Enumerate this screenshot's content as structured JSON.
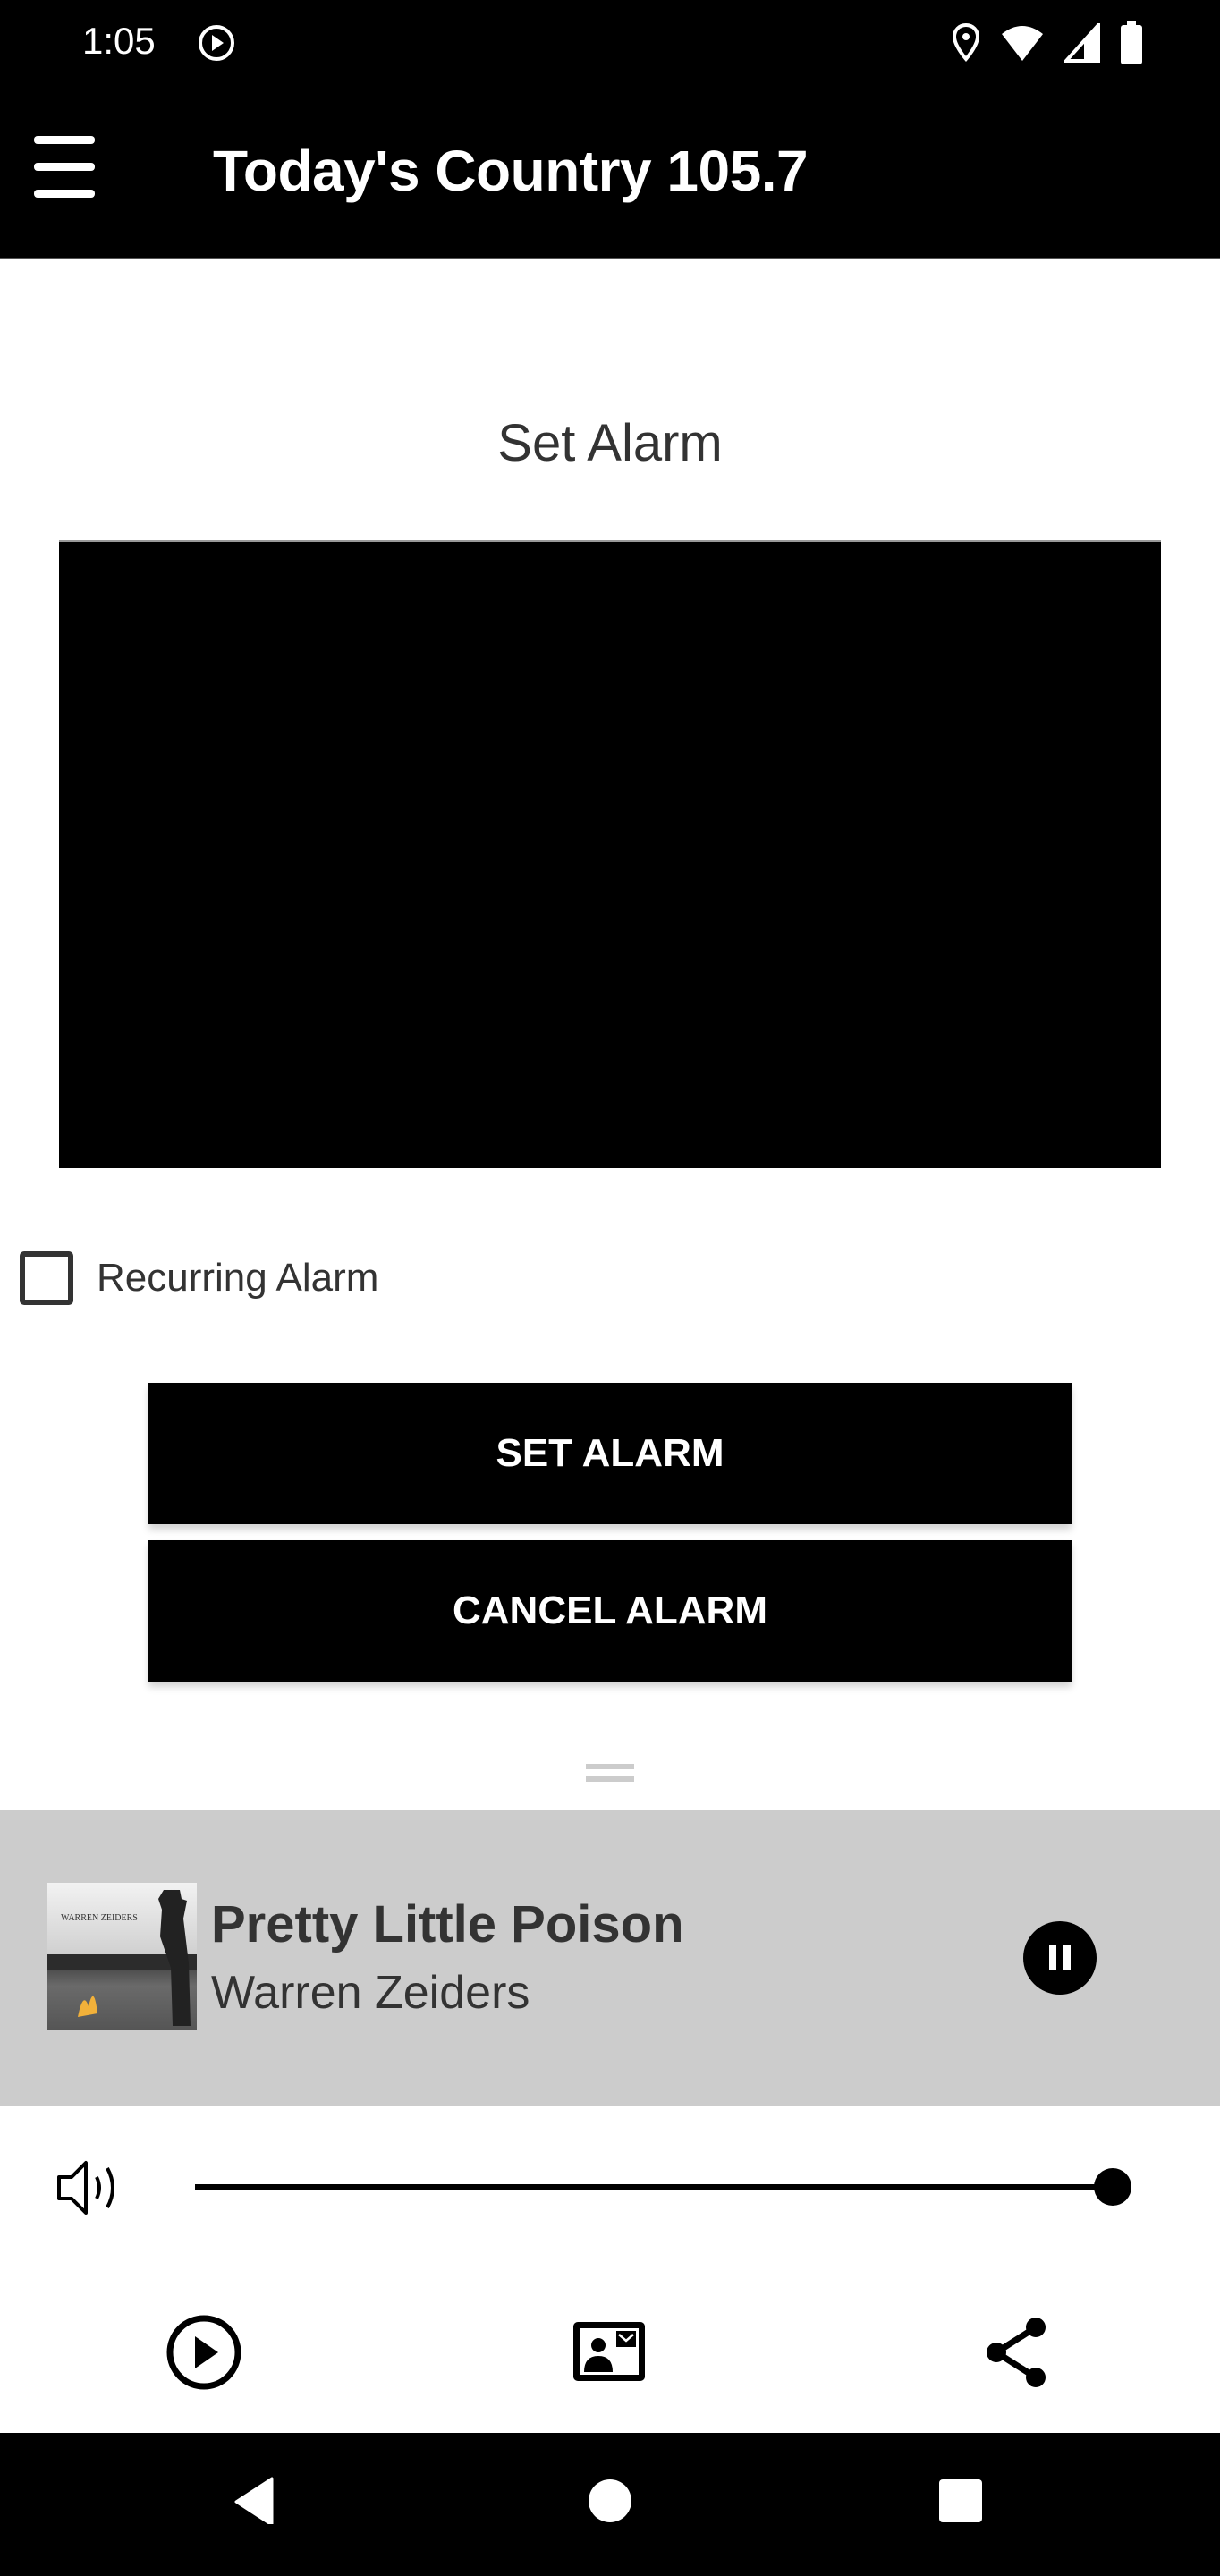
{
  "status_bar": {
    "time": "1:05",
    "icons": [
      "media-play-icon",
      "location-icon",
      "wifi-icon",
      "signal-icon",
      "battery-icon"
    ]
  },
  "app_bar": {
    "title": "Today's Country 105.7",
    "menu_icon": "hamburger-menu-icon"
  },
  "alarm": {
    "title": "Set Alarm",
    "recurring_label": "Recurring Alarm",
    "recurring_checked": false,
    "set_button": "SET ALARM",
    "cancel_button": "CANCEL ALARM"
  },
  "player": {
    "song_title": "Pretty Little Poison",
    "artist": "Warren Zeiders",
    "album_art_text": "WARREN ZEIDERS",
    "state": "playing",
    "volume_fraction": 1.0,
    "background_color": "#cccccc"
  },
  "bottom_actions": [
    {
      "icon": "play-circle-icon"
    },
    {
      "icon": "contact-card-icon"
    },
    {
      "icon": "share-icon"
    }
  ],
  "nav_bar": {
    "icons": [
      "back-icon",
      "home-icon",
      "recents-icon"
    ]
  }
}
